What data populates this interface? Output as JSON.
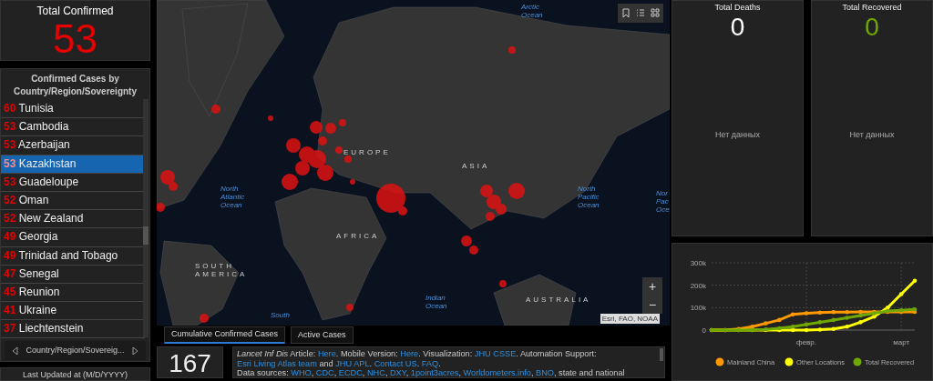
{
  "total_confirmed": {
    "title": "Total Confirmed",
    "value": "53"
  },
  "country_list": {
    "title": "Confirmed Cases by Country/Region/Sovereignty",
    "rows": [
      {
        "count": "60",
        "name": "Tunisia",
        "selected": false
      },
      {
        "count": "53",
        "name": "Cambodia",
        "selected": false
      },
      {
        "count": "53",
        "name": "Azerbaijan",
        "selected": false
      },
      {
        "count": "53",
        "name": "Kazakhstan",
        "selected": true
      },
      {
        "count": "53",
        "name": "Guadeloupe",
        "selected": false
      },
      {
        "count": "52",
        "name": "Oman",
        "selected": false
      },
      {
        "count": "52",
        "name": "New Zealand",
        "selected": false
      },
      {
        "count": "49",
        "name": "Georgia",
        "selected": false
      },
      {
        "count": "49",
        "name": "Trinidad and Tobago",
        "selected": false
      },
      {
        "count": "47",
        "name": "Senegal",
        "selected": false
      },
      {
        "count": "45",
        "name": "Reunion",
        "selected": false
      },
      {
        "count": "41",
        "name": "Ukraine",
        "selected": false
      },
      {
        "count": "37",
        "name": "Liechtenstein",
        "selected": false
      }
    ],
    "selector": "Country/Region/Sovereig..."
  },
  "last_updated": "Last Updated at (M/D/YYYY)",
  "map": {
    "labels": [
      {
        "kind": "ocean",
        "lines": [
          "Arctic",
          "Ocean"
        ]
      },
      {
        "kind": "ocean",
        "lines": [
          "North",
          "Atlantic",
          "Ocean"
        ]
      },
      {
        "kind": "region",
        "lines": [
          "EUROPE"
        ]
      },
      {
        "kind": "region",
        "lines": [
          "ASIA"
        ]
      },
      {
        "kind": "ocean",
        "lines": [
          "North",
          "Pacific",
          "Ocean"
        ]
      },
      {
        "kind": "ocean",
        "lines": [
          "Nor",
          "Pac",
          "Oce"
        ]
      },
      {
        "kind": "region",
        "lines": [
          "AFRICA"
        ]
      },
      {
        "kind": "region",
        "lines": [
          "SOUTH",
          "AMERICA"
        ]
      },
      {
        "kind": "ocean",
        "lines": [
          "Indian",
          "Ocean"
        ]
      },
      {
        "kind": "region",
        "lines": [
          "AUSTRALIA"
        ]
      },
      {
        "kind": "ocean",
        "lines": [
          "South"
        ]
      }
    ],
    "attribution": "Esri, FAO, NOAA",
    "zoom_in": "+",
    "zoom_out": "−"
  },
  "tabs": [
    {
      "label": "Cumulative Confirmed Cases",
      "selected": true
    },
    {
      "label": "Active Cases",
      "selected": false
    }
  ],
  "count_box": "167",
  "info": [
    {
      "kind": "text",
      "text": "*Lancet Inf Dis* Article: "
    },
    {
      "kind": "link",
      "text": "Here"
    },
    {
      "kind": "text",
      "text": ". Mobile Version: "
    },
    {
      "kind": "link",
      "text": "Here"
    },
    {
      "kind": "text",
      "text": ". Visualization: "
    },
    {
      "kind": "link",
      "text": "JHU CSSE"
    },
    {
      "kind": "text",
      "text": ". Automation Support: "
    },
    {
      "kind": "link",
      "text": "Esri Living Atlas team"
    },
    {
      "kind": "text",
      "text": " and "
    },
    {
      "kind": "link",
      "text": "JHU APL"
    },
    {
      "kind": "text",
      "text": ". "
    },
    {
      "kind": "link",
      "text": "Contact US"
    },
    {
      "kind": "text",
      "text": ". "
    },
    {
      "kind": "link",
      "text": "FAQ"
    },
    {
      "kind": "text",
      "text": "."
    },
    {
      "kind": "break"
    },
    {
      "kind": "text",
      "text": "Data sources: "
    },
    {
      "kind": "link",
      "text": "WHO"
    },
    {
      "kind": "text",
      "text": ", "
    },
    {
      "kind": "link",
      "text": "CDC"
    },
    {
      "kind": "text",
      "text": ", "
    },
    {
      "kind": "link",
      "text": "ECDC"
    },
    {
      "kind": "text",
      "text": ", "
    },
    {
      "kind": "link",
      "text": "NHC"
    },
    {
      "kind": "text",
      "text": ", "
    },
    {
      "kind": "link",
      "text": "DXY"
    },
    {
      "kind": "text",
      "text": ", "
    },
    {
      "kind": "link",
      "text": "1point3acres"
    },
    {
      "kind": "text",
      "text": ", "
    },
    {
      "kind": "link",
      "text": "Worldometers.info"
    },
    {
      "kind": "text",
      "text": ", "
    },
    {
      "kind": "link",
      "text": "BNO"
    },
    {
      "kind": "text",
      "text": ", state and national"
    }
  ],
  "stats": [
    {
      "kind": "deaths",
      "title": "Total Deaths",
      "value": "0",
      "note": "Нет данных"
    },
    {
      "kind": "recovered",
      "title": "Total Recovered",
      "value": "0",
      "note": "Нет данных"
    }
  ],
  "chart": {
    "chart_data": {
      "type": "line",
      "ylim": [
        0,
        300000
      ],
      "grid": true,
      "legend": "bottom",
      "categories": [
        null,
        null,
        null,
        null,
        null,
        null,
        null,
        "февр.",
        null,
        null,
        null,
        null,
        null,
        null,
        "март",
        null
      ],
      "yticks": [
        {
          "value": 0,
          "label": "0"
        },
        {
          "value": 100000,
          "label": "100k"
        },
        {
          "value": 200000,
          "label": "200k"
        },
        {
          "value": 300000,
          "label": "300k"
        }
      ],
      "series": [
        {
          "name": "Mainland China",
          "color": "#ff9900",
          "values": [
            0,
            0,
            5000,
            15000,
            30000,
            45000,
            70000,
            75000,
            78000,
            80000,
            80000,
            81000,
            81000,
            81000,
            81000,
            81000
          ]
        },
        {
          "name": "Other Locations",
          "color": "#ffff00",
          "values": [
            0,
            0,
            0,
            0,
            0,
            0,
            0,
            0,
            2000,
            5000,
            15000,
            35000,
            60000,
            100000,
            160000,
            220000
          ]
        },
        {
          "name": "Total Recovered",
          "color": "#70a800",
          "values": [
            0,
            0,
            0,
            1000,
            3000,
            8000,
            15000,
            25000,
            35000,
            45000,
            55000,
            65000,
            75000,
            85000,
            88000,
            92000
          ]
        }
      ]
    }
  }
}
